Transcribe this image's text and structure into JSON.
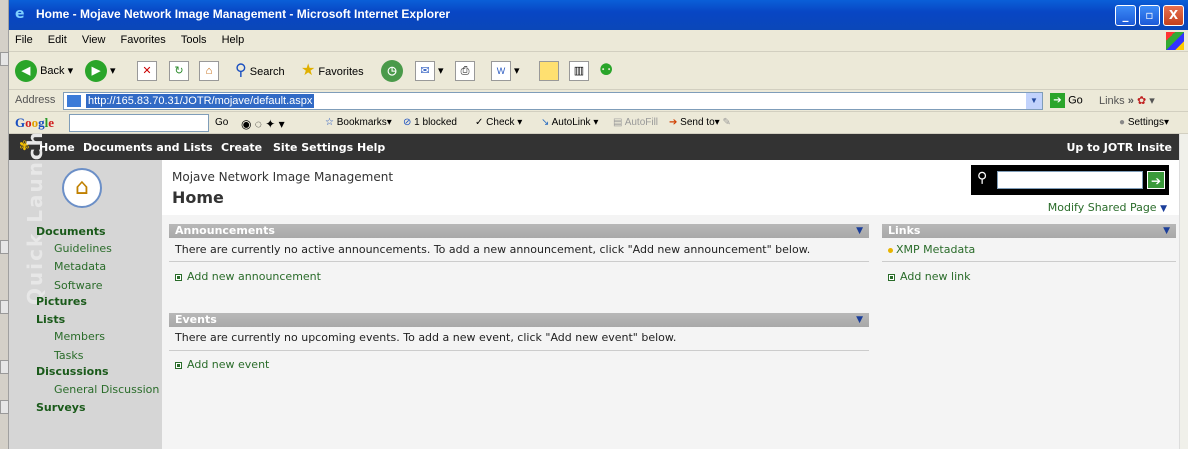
{
  "window": {
    "title": "Home - Mojave Network Image Management - Microsoft Internet Explorer",
    "minimize": "_",
    "maximize": "▫",
    "close": "X"
  },
  "menu": [
    "File",
    "Edit",
    "View",
    "Favorites",
    "Tools",
    "Help"
  ],
  "toolbar": {
    "back_label": "Back",
    "search_label": "Search",
    "favorites_label": "Favorites"
  },
  "address": {
    "label": "Address",
    "url": "http://165.83.70.31/JOTR/mojave/default.aspx",
    "go_label": "Go",
    "links_label": "Links",
    "chevron": "»"
  },
  "googlebar": {
    "logo": "Google",
    "go_label": "Go",
    "bookmarks_label": "Bookmarks",
    "blocked_label": "1 blocked",
    "check_label": "Check",
    "autolink_label": "AutoLink",
    "autofill_label": "AutoFill",
    "sendto_label": "Send to",
    "settings_label": "Settings"
  },
  "nav": {
    "items": [
      "Home",
      "Documents and Lists",
      "Create",
      "Site Settings",
      "Help"
    ],
    "up_link": "Up to JOTR Insite"
  },
  "header": {
    "site_title": "Mojave Network Image Management",
    "page_title": "Home",
    "search_value": "",
    "modify_label": "Modify Shared Page"
  },
  "quick_launch": {
    "watermark": "Quick Launch",
    "sections": [
      {
        "label": "Documents",
        "items": [
          "Guidelines",
          "Metadata",
          "Software"
        ]
      },
      {
        "label": "Pictures",
        "items": []
      },
      {
        "label": "Lists",
        "items": [
          "Members",
          "Tasks"
        ]
      },
      {
        "label": "Discussions",
        "items": [
          "General Discussion"
        ]
      },
      {
        "label": "Surveys",
        "items": []
      }
    ]
  },
  "announcements": {
    "title": "Announcements",
    "empty_text": "There are currently no active announcements. To add a new announcement, click \"Add new announcement\" below.",
    "add_link": "Add new announcement"
  },
  "events": {
    "title": "Events",
    "empty_text": "There are currently no upcoming events. To add a new event, click \"Add new event\" below.",
    "add_link": "Add new event"
  },
  "links": {
    "title": "Links",
    "items": [
      "XMP Metadata"
    ],
    "add_link": "Add new link"
  },
  "colors": {
    "nav_bg": "#333333",
    "link_green": "#2a6c2a",
    "webpart_title_bg": "#a8a8a8"
  }
}
